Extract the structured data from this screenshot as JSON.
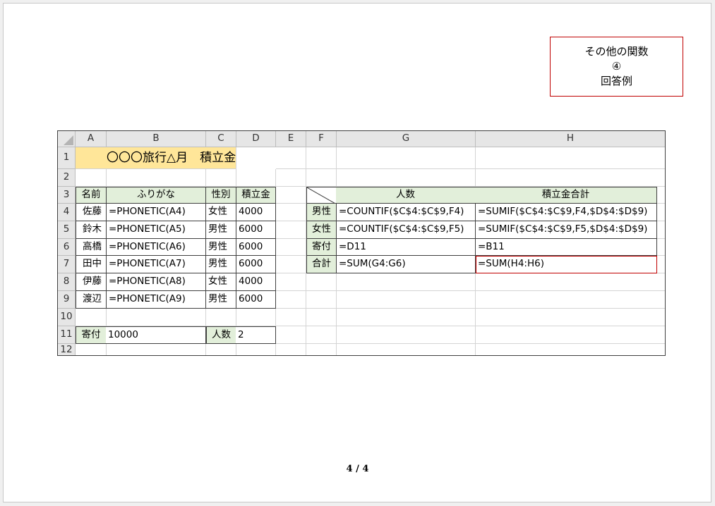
{
  "answer_box": {
    "line1": "その他の関数",
    "line2": "④",
    "line3": "回答例"
  },
  "columns": [
    "A",
    "B",
    "C",
    "D",
    "E",
    "F",
    "G",
    "H"
  ],
  "rows": [
    "1",
    "2",
    "3",
    "4",
    "5",
    "6",
    "7",
    "8",
    "9",
    "10",
    "11",
    "12"
  ],
  "title": "〇〇〇旅行△月　積立金",
  "left_table": {
    "headers": {
      "name": "名前",
      "furigana": "ふりがな",
      "gender": "性別",
      "amount": "積立金"
    },
    "rows": [
      {
        "name": "佐藤",
        "furigana": "=PHONETIC(A4)",
        "gender": "女性",
        "amount": "4000"
      },
      {
        "name": "鈴木",
        "furigana": "=PHONETIC(A5)",
        "gender": "男性",
        "amount": "6000"
      },
      {
        "name": "高橋",
        "furigana": "=PHONETIC(A6)",
        "gender": "男性",
        "amount": "6000"
      },
      {
        "name": "田中",
        "furigana": "=PHONETIC(A7)",
        "gender": "男性",
        "amount": "6000"
      },
      {
        "name": "伊藤",
        "furigana": "=PHONETIC(A8)",
        "gender": "女性",
        "amount": "4000"
      },
      {
        "name": "渡辺",
        "furigana": "=PHONETIC(A9)",
        "gender": "男性",
        "amount": "6000"
      }
    ]
  },
  "donation": {
    "label": "寄付",
    "value": "10000",
    "count_label": "人数",
    "count_value": "2"
  },
  "right_table": {
    "headers": {
      "count": "人数",
      "total": "積立金合計"
    },
    "rows": [
      {
        "label": "男性",
        "count": "=COUNTIF($C$4:$C$9,F4)",
        "total": "=SUMIF($C$4:$C$9,F4,$D$4:$D$9)"
      },
      {
        "label": "女性",
        "count": "=COUNTIF($C$4:$C$9,F5)",
        "total": "=SUMIF($C$4:$C$9,F5,$D$4:$D$9)"
      },
      {
        "label": "寄付",
        "count": "=D11",
        "total": "=B11"
      },
      {
        "label": "合計",
        "count": "=SUM(G4:G6)",
        "total": "=SUM(H4:H6)"
      }
    ]
  },
  "colors": {
    "header_green": "#e2efda",
    "title_yellow": "#ffe699",
    "selection_red": "#c00000"
  },
  "page_indicator": "4 / 4"
}
